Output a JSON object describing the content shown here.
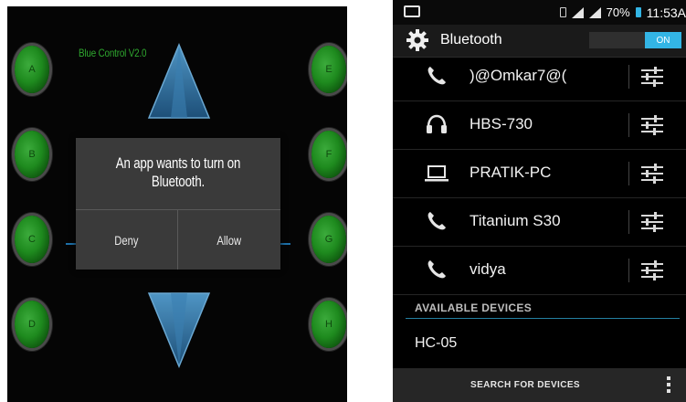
{
  "left_app": {
    "title": "Blue Control V2.0",
    "buttons_left": [
      "A",
      "B",
      "C",
      "D"
    ],
    "buttons_right": [
      "E",
      "F",
      "G",
      "H"
    ],
    "dialog": {
      "message": "An app wants to turn on Bluetooth.",
      "deny_label": "Deny",
      "allow_label": "Allow"
    },
    "colors": {
      "button_green": "#1e8a1e",
      "arrow_blue": "#2a6c9a"
    }
  },
  "right_app": {
    "statusbar": {
      "battery": "70%",
      "time": "11:53A"
    },
    "actionbar": {
      "title": "Bluetooth",
      "toggle_label": "ON"
    },
    "paired_devices": [
      {
        "name": ")@Omkar7@(",
        "icon": "phone-icon"
      },
      {
        "name": "HBS-730",
        "icon": "headphones-icon"
      },
      {
        "name": "PRATIK-PC",
        "icon": "laptop-icon"
      },
      {
        "name": "Titanium S30",
        "icon": "phone-icon"
      },
      {
        "name": "vidya",
        "icon": "phone-icon"
      }
    ],
    "available_header": "AVAILABLE DEVICES",
    "available_devices": [
      {
        "name": "HC-05"
      }
    ],
    "search_label": "SEARCH FOR DEVICES",
    "colors": {
      "accent": "#33b5e5"
    }
  }
}
